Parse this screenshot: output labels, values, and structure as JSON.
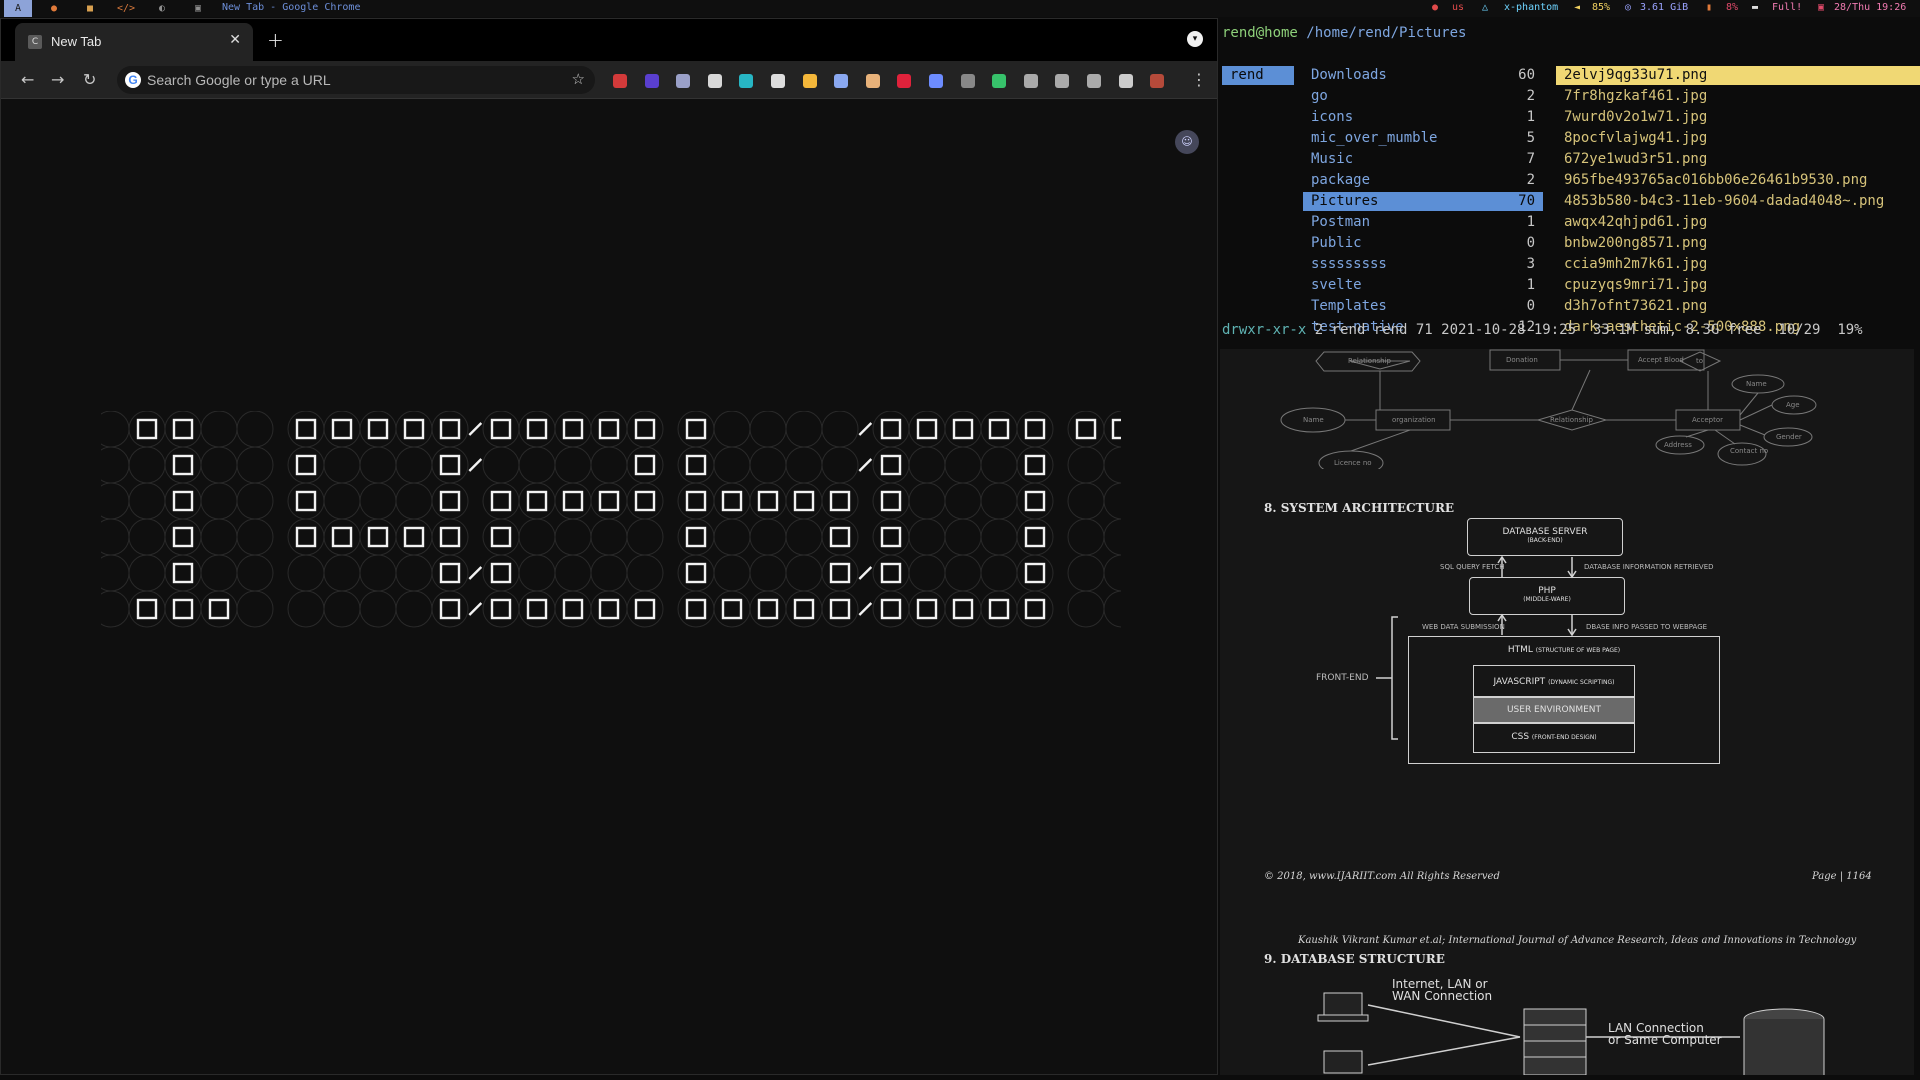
{
  "topbar": {
    "workspaces": [
      "A",
      "●",
      "■",
      "</>",
      "◐",
      "▣"
    ],
    "window_title": "New Tab - Google Chrome",
    "tray": {
      "keyboard": "us",
      "wifi": "x-phantom",
      "volume": "85%",
      "memory": "3.61 GiB",
      "cpu": "8%",
      "battery": "Full!",
      "datetime": "28/Thu 19:26"
    }
  },
  "chrome": {
    "tab_title": "New Tab",
    "tab_favicon": "C",
    "omnibox_placeholder": "Search Google or type a URL",
    "extensions": [
      {
        "icon": "ext-red-icon",
        "color": "#d33a3a"
      },
      {
        "icon": "ext-purple-icon",
        "color": "#5a3fcf"
      },
      {
        "icon": "ext-glasses-icon",
        "color": "#9aa0c8"
      },
      {
        "icon": "react-icon",
        "color": "#d8d8d8"
      },
      {
        "icon": "ext-teal-icon",
        "color": "#27b6c4"
      },
      {
        "icon": "ext-circle-icon",
        "color": "#dddddd"
      },
      {
        "icon": "ext-yellow-icon",
        "color": "#f4b73a"
      },
      {
        "icon": "ext-moon-icon",
        "color": "#8aa8f0"
      },
      {
        "icon": "ext-cookie-icon",
        "color": "#e8b27a"
      },
      {
        "icon": "ext-red-dot-icon",
        "color": "#e0223b"
      },
      {
        "icon": "ext-spiral-icon",
        "color": "#6d8cff"
      },
      {
        "icon": "ext-bracket-icon",
        "color": "#888888"
      },
      {
        "icon": "ext-green-icon",
        "color": "#37c26b"
      },
      {
        "icon": "ext-cursor-icon",
        "color": "#aaaaaa"
      },
      {
        "icon": "ext-crosshair-icon",
        "color": "#aaaaaa"
      },
      {
        "icon": "ext-window-icon",
        "color": "#aaaaaa"
      },
      {
        "icon": "puzzle-icon",
        "color": "#cccccc"
      },
      {
        "icon": "profile-avatar-icon",
        "color": "#b54a3a"
      }
    ],
    "clock_digits": "192607"
  },
  "ranger": {
    "user": "rend@home",
    "path": "/home/rend/Pictures",
    "parent": "rend",
    "dirs": [
      {
        "name": "Downloads",
        "count": "60"
      },
      {
        "name": "go",
        "count": "2"
      },
      {
        "name": "icons",
        "count": "1"
      },
      {
        "name": "mic_over_mumble",
        "count": "5"
      },
      {
        "name": "Music",
        "count": "7"
      },
      {
        "name": "package",
        "count": "2"
      },
      {
        "name": "Pictures",
        "count": "70"
      },
      {
        "name": "Postman",
        "count": "1"
      },
      {
        "name": "Public",
        "count": "0"
      },
      {
        "name": "sssssssss",
        "count": "3"
      },
      {
        "name": "svelte",
        "count": "1"
      },
      {
        "name": "Templates",
        "count": "0"
      },
      {
        "name": "test-native",
        "count": "12"
      }
    ],
    "selected_dir": "Pictures",
    "files": [
      "2elvj9qg33u71.png",
      "7fr8hgzkaf461.jpg",
      "7wurd0v2o1w71.jpg",
      "8pocfvlajwg41.jpg",
      "672ye1wud3r51.png",
      "965fbe493765ac016bb06e26461b9530.png",
      "4853b580-b4c3-11eb-9604-dadad4048~.png",
      "awqx42qhjpd61.jpg",
      "bnbw200ng8571.png",
      "ccia9mh2m7k61.jpg",
      "cpuzyqs9mri71.jpg",
      "d3h7ofnt73621.png",
      "dark-aesthetic-2-500x888.png"
    ],
    "status": {
      "perm": "drwxr-xr-x",
      "info": " 2 rend rend 71 2021-10-28 19:25",
      "sum": "33.1M sum, 8.3G free",
      "pos": "10/29",
      "pct": "19%"
    }
  },
  "document": {
    "er_labels": [
      "Relationship",
      "Donation",
      "Accept Blood",
      "to",
      "Name",
      "organization",
      "Relationship",
      "Acceptor",
      "Age",
      "Gender",
      "Licence no",
      "Address",
      "Contact no",
      "Name"
    ],
    "section8": "8. SYSTEM ARCHITECTURE",
    "arch": {
      "db": "DATABASE SERVER",
      "db_sub": "(BACK-END)",
      "sql": "SQL QUERY FETCH",
      "dbinfo": "DATABASE INFORMATION RETRIEVED",
      "php": "PHP",
      "php_sub": "(MIDDLE-WARE)",
      "websub": "WEB DATA SUBMISSION",
      "dbase": "DBASE INFO PASSED TO WEBPAGE",
      "html": "HTML",
      "html_sub": "(STRUCTURE OF WEB PAGE)",
      "js": "JAVASCRIPT",
      "js_sub": "(DYNAMIC SCRIPTING)",
      "user_env": "USER ENVIRONMENT",
      "css": "CSS",
      "css_sub": "(FRONT-END DESIGN)",
      "frontend": "FRONT-END"
    },
    "copyright": "© 2018, www.IJARIIT.com All Rights Reserved",
    "page": "Page | 1164",
    "citation": "Kaushik Vikrant Kumar et.al; International Journal of Advance Research, Ideas and Innovations in Technology",
    "section9": "9. DATABASE STRUCTURE",
    "net1": "Internet, LAN or",
    "net2": "WAN Connection",
    "lan1": "LAN Connection",
    "lan2": "or Same Computer"
  }
}
